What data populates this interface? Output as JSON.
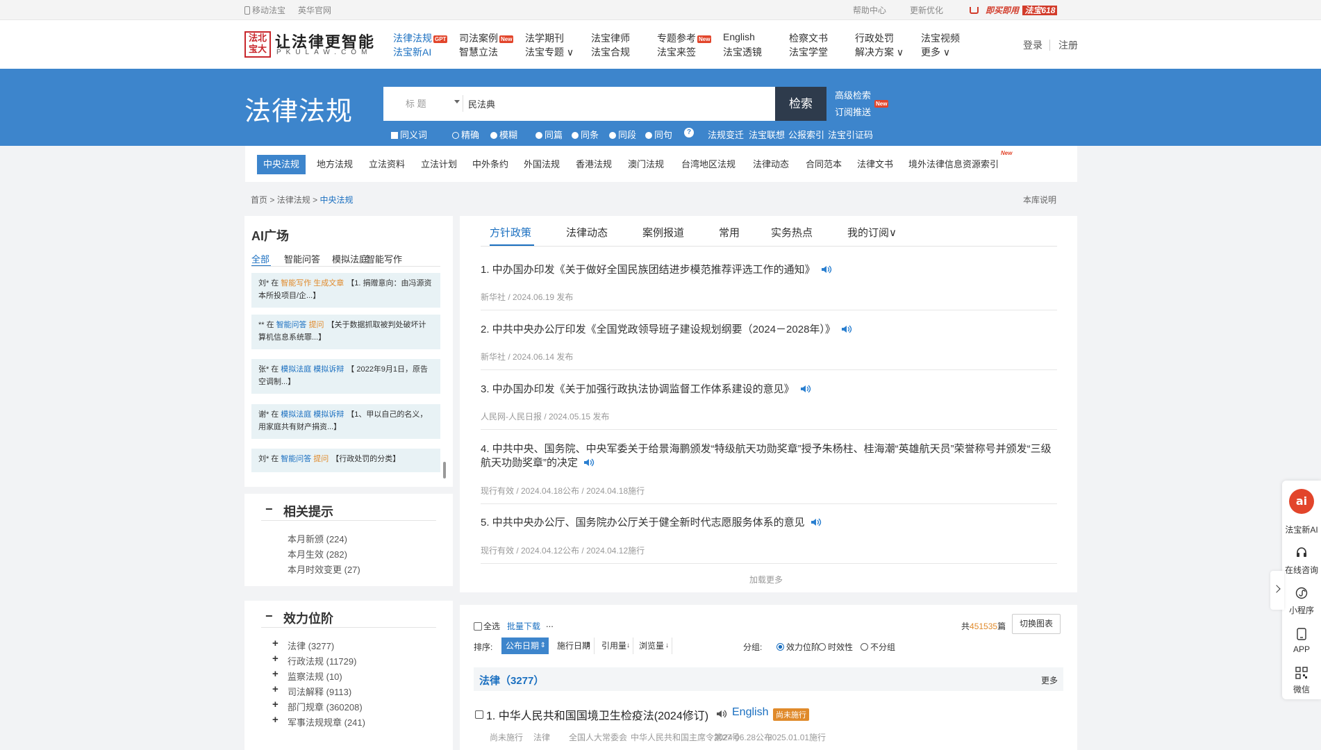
{
  "topbar": {
    "mobile": "移动法宝",
    "english_site": "英华官网",
    "help": "帮助中心",
    "update": "更新优化",
    "buy": "即买即用",
    "buy_badge": "法宝618"
  },
  "logo": {
    "seal": "法北宝大",
    "cn": "让法律更智能",
    "url": "PKULAW.COM"
  },
  "nav": [
    {
      "l1": "法律法规",
      "l2": "法宝新AI",
      "badge": "GPT"
    },
    {
      "l1": "司法案例",
      "l2": "智慧立法",
      "badge": "New"
    },
    {
      "l1": "法学期刊",
      "l2": "法宝专题 ∨"
    },
    {
      "l1": "法宝律师",
      "l2": "法宝合规"
    },
    {
      "l1": "专题参考",
      "l2": "法宝来签",
      "badge": "New"
    },
    {
      "l1": "English",
      "l2": "法宝透镜"
    },
    {
      "l1": "检察文书",
      "l2": "法宝学堂"
    },
    {
      "l1": "行政处罚",
      "l2": "解决方案 ∨"
    },
    {
      "l1": "法宝视频",
      "l2": "更多 ∨"
    }
  ],
  "auth": {
    "login": "登录",
    "register": "注册"
  },
  "banner": {
    "title": "法律法规",
    "field": "标 题",
    "query": "民法典",
    "search": "检索",
    "advanced": "高级检索",
    "subscribe": "订阅推送",
    "new_badge": "New",
    "options": [
      "同义词",
      "精确",
      "模糊",
      "同篇",
      "同条",
      "同段",
      "同句",
      "?",
      "法规变迁",
      "法宝联想",
      "公报索引",
      "法宝引证码"
    ]
  },
  "categories": [
    "中央法规",
    "地方法规",
    "立法资料",
    "立法计划",
    "中外条约",
    "外国法规",
    "香港法规",
    "澳门法规",
    "台湾地区法规",
    "法律动态",
    "合同范本",
    "法律文书",
    "境外法律信息资源索引"
  ],
  "cat_new": "New",
  "breadcrumb": {
    "home": "首页",
    "sep": ">",
    "l2": "法律法规",
    "l3": "中央法规",
    "right": "本库说明"
  },
  "ai": {
    "title": "AI广场",
    "tabs": [
      "全部",
      "智能问答",
      "模拟法庭",
      "智能写作"
    ],
    "cards": [
      {
        "user": "刘*",
        "in": "在",
        "app": "智能写作",
        "act": "生成文章",
        "text": "【1. 捐赠意向：由冯源资本所投项目/企...】"
      },
      {
        "user": "**",
        "in": "在",
        "app": "智能问答",
        "act": "提问",
        "text": "【关于数据抓取被判处破坏计算机信息系统罪...】"
      },
      {
        "user": "张*",
        "in": "在",
        "app": "模拟法庭",
        "act": "模拟诉辩",
        "text": "【 2022年9月1日，原告空调制...】"
      },
      {
        "user": "谢*",
        "in": "在",
        "app": "模拟法庭",
        "act": "模拟诉辩",
        "text": "【1、甲以自己的名义，用家庭共有财产捐资...】"
      },
      {
        "user": "刘*",
        "in": "在",
        "app": "智能问答",
        "act": "提问",
        "text": "【行政处罚的分类】"
      }
    ]
  },
  "hints": {
    "title": "相关提示",
    "minus": "−",
    "items": [
      "本月新颁 (224)",
      "本月生效 (282)",
      "本月时效变更 (27)"
    ]
  },
  "levels": {
    "title": "效力位阶",
    "minus": "−",
    "plus": "+",
    "items": [
      "法律 (3277)",
      "行政法规 (11729)",
      "监察法规 (10)",
      "司法解释 (9113)",
      "部门规章 (360208)",
      "军事法规规章 (241)"
    ]
  },
  "news_tabs": [
    "方针政策",
    "法律动态",
    "案例报道",
    "常用",
    "实务热点",
    "我的订阅∨"
  ],
  "news": [
    {
      "t": "1. 中办国办印发《关于做好全国民族团结进步模范推荐评选工作的通知》",
      "m": "新华社 / 2024.06.19 发布"
    },
    {
      "t": "2. 中共中央办公厅印发《全国党政领导班子建设规划纲要（2024－2028年）》",
      "m": "新华社 / 2024.06.14 发布"
    },
    {
      "t": "3. 中办国办印发《关于加强行政执法协调监督工作体系建设的意见》",
      "m": "人民网-人民日报 / 2024.05.15 发布"
    },
    {
      "t": "4. 中共中央、国务院、中央军委关于给景海鹏颁发“特级航天功勋奖章”授予朱杨柱、桂海潮“英雄航天员”荣誉称号并颁发“三级航天功勋奖章”的决定",
      "m": "现行有效 / 2024.04.18公布 / 2024.04.18施行"
    },
    {
      "t": "5. 中共中央办公厅、国务院办公厅关于健全新时代志愿服务体系的意见",
      "m": "现行有效 / 2024.04.12公布 / 2024.04.12施行"
    }
  ],
  "load_more": "加载更多",
  "results": {
    "select_all": "全选",
    "batch": "批量下载",
    "more": "...",
    "total_prefix": "共",
    "total": "451535",
    "total_suffix": "篇",
    "switch": "切换图表",
    "sort_label": "排序:",
    "sorts": [
      "公布日期",
      "施行日期",
      "引用量",
      "浏览量"
    ],
    "group_label": "分组:",
    "groups": [
      "效力位阶",
      "时效性",
      "不分组"
    ],
    "section": "法律（3277）",
    "section_more": "更多",
    "first": {
      "title": "1. 中华人民共和国国境卫生检疫法(2024修订)",
      "english": "English",
      "tag": "尚未施行",
      "meta": [
        "尚未施行",
        "法律",
        "全国人大常委会",
        "中华人民共和国主席令第27号",
        "2024.06.28公布",
        "2025.01.01施行"
      ]
    }
  },
  "right_float": [
    "法宝新AI",
    "在线咨询",
    "小程序",
    "APP",
    "微信"
  ],
  "colors": {
    "accent": "#3d85cc",
    "dark_button": "#2e3b4c",
    "badge": "#e2452b",
    "orange": "#e08a2b"
  }
}
